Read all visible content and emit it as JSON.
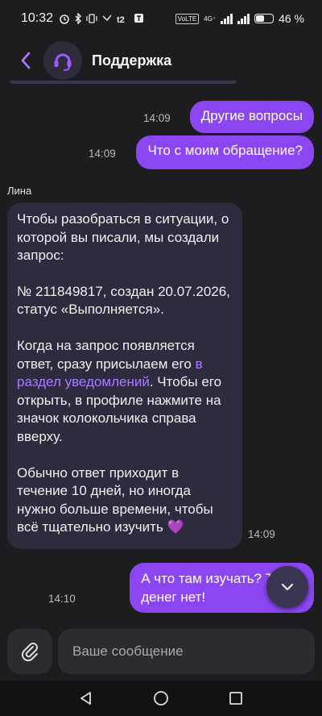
{
  "status_bar": {
    "time": "10:32",
    "volte": "VoLTE",
    "network": "4G⁺",
    "battery_percent_label": "46 %",
    "battery_level": 0.46
  },
  "header": {
    "title": "Поддержка",
    "avatar_icon": "headset-icon"
  },
  "messages": {
    "out1": {
      "text": "Другие вопросы",
      "time": "14:09"
    },
    "out2": {
      "text": "Что с моим обращение?",
      "time": "14:09"
    },
    "incoming": {
      "sender": "Лина",
      "p1": "Чтобы разобраться в ситуации, о которой вы писали, мы создали запрос:",
      "p2": "№ 211849817, создан 20.07.2026, статус «Выполняется».",
      "p3_before": "Когда на запрос появляется ответ, сразу присылаем его ",
      "p3_link": "в раздел уведомлений",
      "p3_after": ". Чтобы его открыть, в профиле нажмите на значок колокольчика справа вверху.",
      "p4": "Обычно ответ приходит в течение 10 дней, но иногда нужно больше времени, чтобы всё тщательно изучить 💜",
      "time": "14:09"
    },
    "out3": {
      "line1": "А что там изучать? Товар",
      "line2": "денег нет!",
      "time": "14:10"
    }
  },
  "composer": {
    "placeholder": "Ваше сообщение"
  },
  "colors": {
    "accent": "#8b46f2",
    "incoming_bubble": "#2f2b3e",
    "background": "#1d1d1f",
    "link": "#a97bff"
  }
}
